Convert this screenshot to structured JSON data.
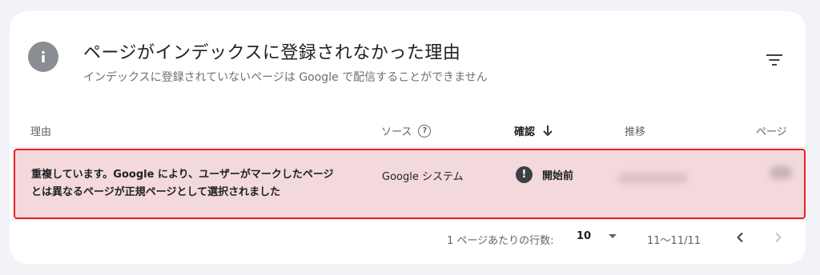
{
  "header": {
    "title": "ページがインデックスに登録されなかった理由",
    "subtitle": "インデックスに登録されていないページは Google で配信することができません"
  },
  "table": {
    "columns": {
      "reason": "理由",
      "source": "ソース",
      "validation": "確認",
      "trend": "推移",
      "pages": "ページ"
    },
    "rows": [
      {
        "reason": "重複しています。Google により、ユーザーがマークしたページとは異なるページが正規ページとして選択されました",
        "source": "Google システム",
        "validation": "開始前"
      }
    ]
  },
  "pagination": {
    "rows_per_page_label": "1 ページあたりの行数:",
    "rows_per_page_value": "10",
    "range": "11〜11/11"
  },
  "icons": {
    "info": "info-icon",
    "filter": "filter-icon",
    "help": "help-icon",
    "sort": "arrow-down-icon",
    "alert": "alert-icon",
    "prev": "chevron-left-icon",
    "next": "chevron-right-icon"
  },
  "colors": {
    "highlight_border": "#e8202a",
    "highlight_fill": "#f3d9db"
  }
}
